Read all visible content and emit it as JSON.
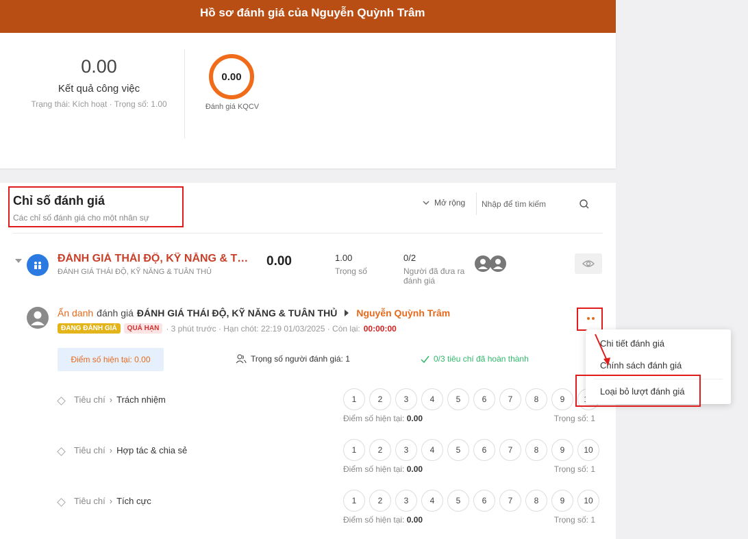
{
  "header": {
    "title": "Hồ sơ đánh giá của Nguyễn Quỳnh Trâm"
  },
  "summary": {
    "score": "0.00",
    "label": "Kết quả công việc",
    "meta": "Trạng thái: Kích hoạt · Trọng số: 1.00",
    "ring_value": "0.00",
    "ring_label": "Đánh giá KQCV",
    "ring_color": "#f06b1a"
  },
  "section": {
    "title": "Chỉ số đánh giá",
    "subtitle": "Các chỉ số đánh giá cho một nhân sự",
    "expand_label": "Mở rộng",
    "search_placeholder": "Nhập để tìm kiếm"
  },
  "criterion": {
    "title": "ĐÁNH GIÁ THÁI ĐỘ, KỸ NĂNG & TUÂN THỦ",
    "subtitle": "ĐÁNH GIÁ THÁI ĐỘ, KỸ NĂNG & TUÂN THỦ",
    "score": "0.00",
    "weight_value": "1.00",
    "weight_label": "Trọng số",
    "evaluated_value": "0/2",
    "evaluated_label": "Người đã đưa ra đánh giá"
  },
  "evaluation": {
    "evaluator": "Ẩn danh",
    "verb": "đánh giá",
    "criterion": "ĐÁNH GIÁ THÁI ĐỘ, KỸ NĂNG & TUÂN THỦ",
    "target": "Nguyễn Quỳnh Trâm",
    "badge_status": "ĐANG ĐÁNH GIÁ",
    "badge_overdue": "QUÁ HẠN",
    "time_info": "· 3 phút trước · Hạn chót: 22:19 01/03/2025 · Còn lại:",
    "remaining": "00:00:00",
    "current_score": "Điểm số hiện tại: 0.00",
    "evaluator_weight": "Trọng số người đánh giá: 1",
    "completed": "0/3 tiêu chí đã hoàn thành"
  },
  "rows": [
    {
      "prefix": "Tiêu chí",
      "name": "Trách nhiệm",
      "cur_label": "Điểm số hiện tại:",
      "cur_value": "0.00",
      "weight": "Trọng số: 1"
    },
    {
      "prefix": "Tiêu chí",
      "name": "Hợp tác & chia sẻ",
      "cur_label": "Điểm số hiện tại:",
      "cur_value": "0.00",
      "weight": "Trọng số: 1"
    },
    {
      "prefix": "Tiêu chí",
      "name": "Tích cực",
      "cur_label": "Điểm số hiện tại:",
      "cur_value": "0.00",
      "weight": "Trọng số: 1"
    }
  ],
  "score_options": [
    "1",
    "2",
    "3",
    "4",
    "5",
    "6",
    "7",
    "8",
    "9",
    "10"
  ],
  "menu": {
    "detail": "Chi tiết đánh giá",
    "policy": "Chính sách đánh giá",
    "remove": "Loại bỏ lượt đánh giá"
  },
  "colors": {
    "header": "#b94e14",
    "accent": "#e56a1c",
    "highlight": "#e01b1b"
  }
}
